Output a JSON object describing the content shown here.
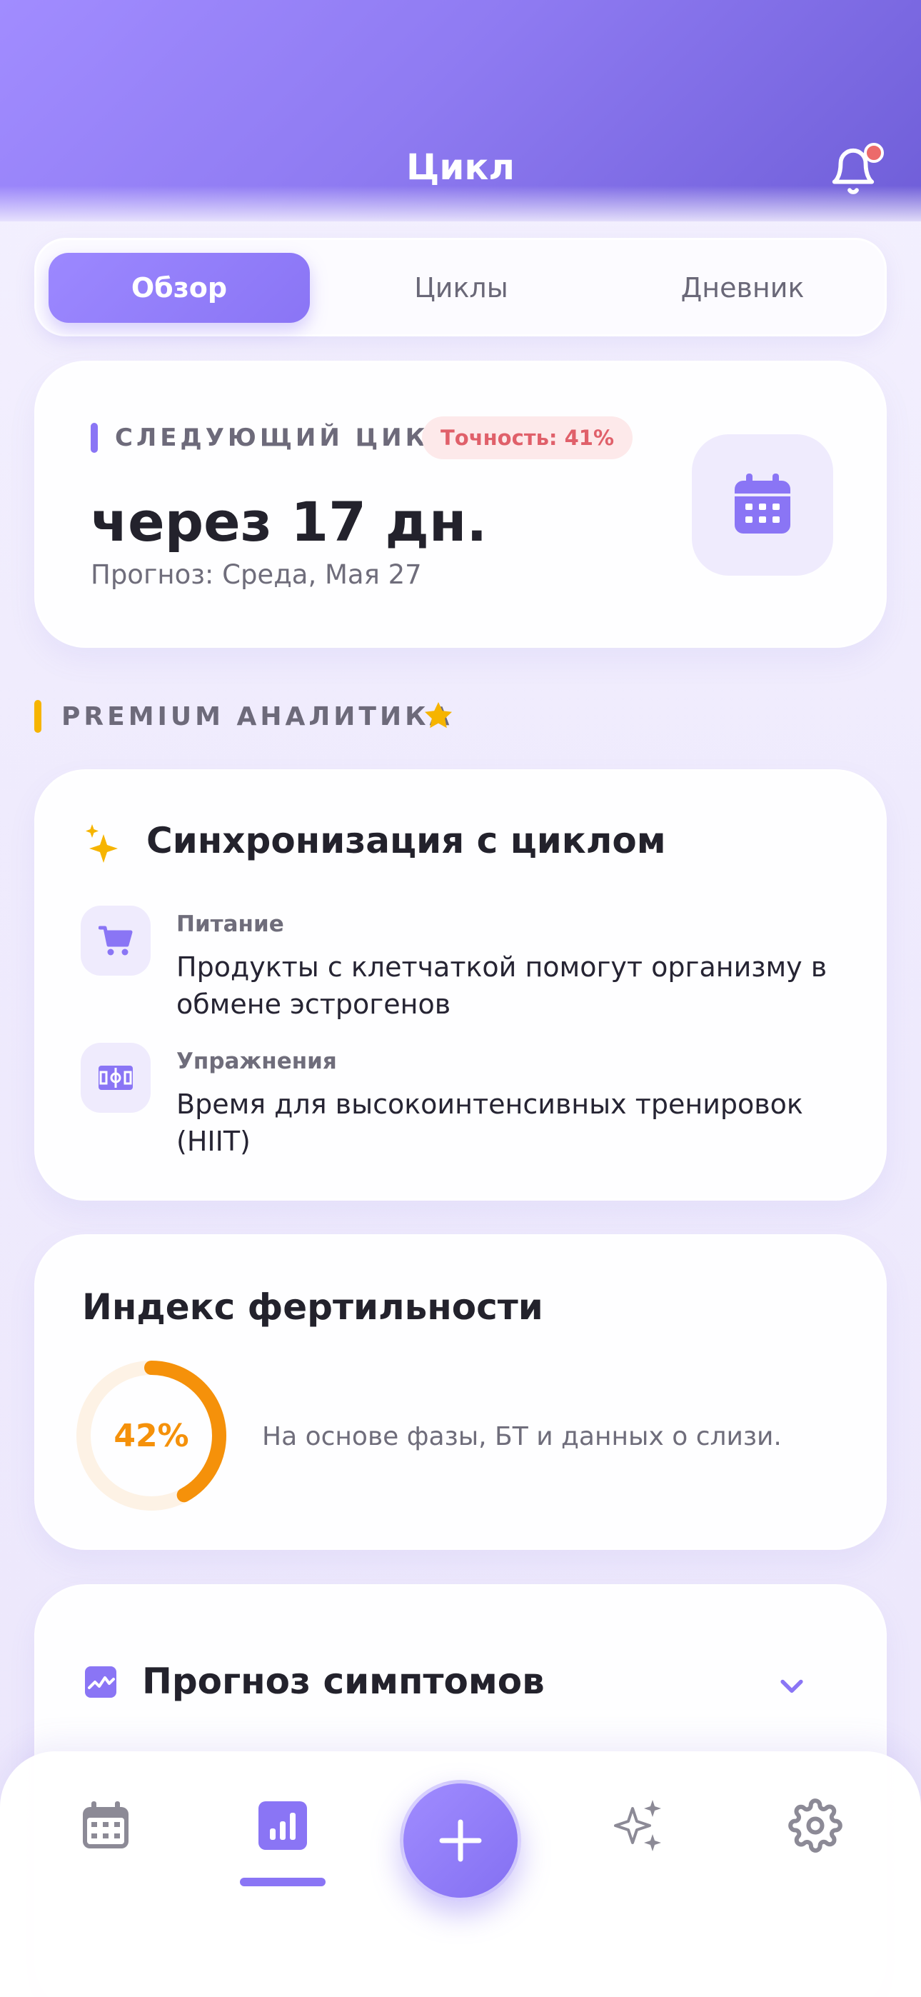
{
  "header": {
    "title": "Цикл",
    "has_notification": true
  },
  "tabs": [
    {
      "label": "Обзор",
      "active": true
    },
    {
      "label": "Циклы",
      "active": false
    },
    {
      "label": "Дневник",
      "active": false
    }
  ],
  "next_cycle": {
    "label": "СЛЕДУЮЩИЙ ЦИКЛ",
    "accuracy": "Точность: 41%",
    "days": "через 17 дн.",
    "forecast": "Прогноз: Среда, Мая 27"
  },
  "premium": {
    "label": "PREMIUM АНАЛИТИКА"
  },
  "sync": {
    "title": "Синхронизация с циклом",
    "items": [
      {
        "category": "Питание",
        "line1": "Продукты с клетчаткой помогут организму в",
        "line2": "обмене эстрогенов",
        "icon": "cart-icon"
      },
      {
        "category": "Упражнения",
        "line1": "Время для высокоинтенсивных тренировок",
        "line2": "(HIIT)",
        "icon": "field-icon"
      }
    ]
  },
  "fertility": {
    "title": "Индекс фертильности",
    "value": 42,
    "value_label": "42%",
    "description": "На основе фазы, БТ и данных о слизи."
  },
  "symptoms": {
    "title": "Прогноз симптомов"
  },
  "colors": {
    "accent": "#8a75f5",
    "orange": "#f5910a",
    "yellow": "#f6b400",
    "danger": "#e0606a"
  },
  "nav": [
    "calendar-icon",
    "stats-icon",
    "plus-icon",
    "sparkles-icon",
    "gear-icon"
  ]
}
